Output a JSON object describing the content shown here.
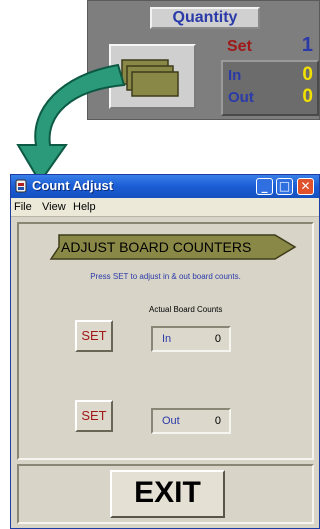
{
  "quantity_panel": {
    "title": "Quantity",
    "set_label": "Set",
    "set_value": "1",
    "in_label": "In",
    "in_value": "0",
    "out_label": "Out",
    "out_value": "0",
    "boards_icon": "stacked-boards-icon"
  },
  "arrow": {
    "icon": "curved-arrow-icon",
    "color": "#2b9a7a"
  },
  "window": {
    "title": "Count Adjust",
    "app_icon": "app-icon",
    "controls": {
      "minimize": "_",
      "maximize": "□",
      "close": "✕"
    },
    "menu": {
      "file": "File",
      "view": "View",
      "help": "Help"
    },
    "banner": "ADJUST BOARD COUNTERS",
    "hint": "Press SET to adjust in & out board counts.",
    "actual_label": "Actual Board Counts",
    "set_in_label": "SET",
    "set_out_label": "SET",
    "in_label": "In",
    "in_value": "0",
    "out_label": "Out",
    "out_value": "0",
    "exit_label": "EXIT"
  },
  "colors": {
    "title_blue": "#1a5cd4",
    "set_red": "#a01818",
    "value_yellow": "#f2e000",
    "label_blue": "#2a3aa8",
    "banner_olive": "#8a8846"
  }
}
